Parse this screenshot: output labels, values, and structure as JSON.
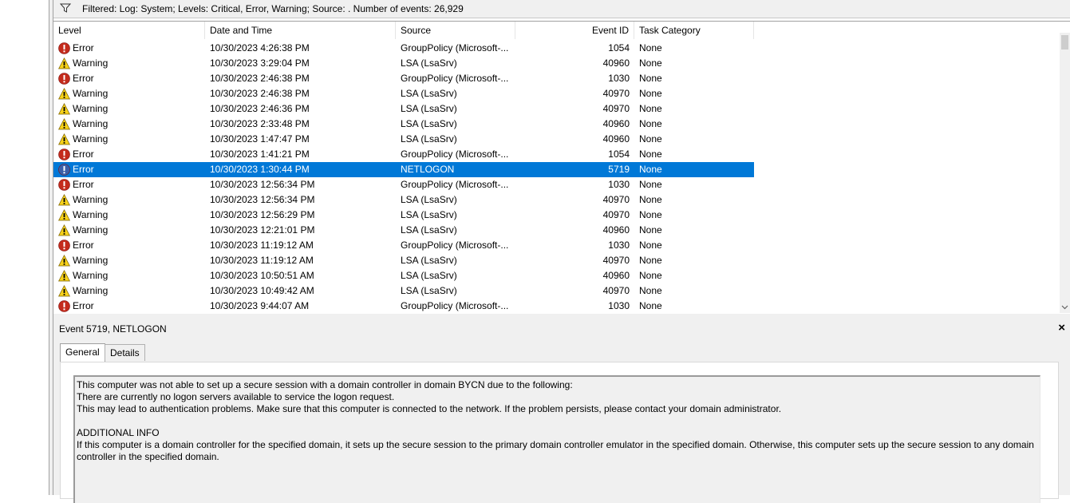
{
  "filter_bar": {
    "text": "Filtered: Log: System; Levels: Critical, Error, Warning; Source: . Number of events: 26,929",
    "icon": "filter-icon"
  },
  "table": {
    "columns": [
      "Level",
      "Date and Time",
      "Source",
      "Event ID",
      "Task Category"
    ],
    "rows": [
      {
        "level": "Error",
        "datetime": "10/30/2023 4:26:38 PM",
        "source": "GroupPolicy (Microsoft-...",
        "event_id": "1054",
        "category": "None"
      },
      {
        "level": "Warning",
        "datetime": "10/30/2023 3:29:04 PM",
        "source": "LSA (LsaSrv)",
        "event_id": "40960",
        "category": "None"
      },
      {
        "level": "Error",
        "datetime": "10/30/2023 2:46:38 PM",
        "source": "GroupPolicy (Microsoft-...",
        "event_id": "1030",
        "category": "None"
      },
      {
        "level": "Warning",
        "datetime": "10/30/2023 2:46:38 PM",
        "source": "LSA (LsaSrv)",
        "event_id": "40970",
        "category": "None"
      },
      {
        "level": "Warning",
        "datetime": "10/30/2023 2:46:36 PM",
        "source": "LSA (LsaSrv)",
        "event_id": "40970",
        "category": "None"
      },
      {
        "level": "Warning",
        "datetime": "10/30/2023 2:33:48 PM",
        "source": "LSA (LsaSrv)",
        "event_id": "40960",
        "category": "None"
      },
      {
        "level": "Warning",
        "datetime": "10/30/2023 1:47:47 PM",
        "source": "LSA (LsaSrv)",
        "event_id": "40960",
        "category": "None"
      },
      {
        "level": "Error",
        "datetime": "10/30/2023 1:41:21 PM",
        "source": "GroupPolicy (Microsoft-...",
        "event_id": "1054",
        "category": "None"
      },
      {
        "level": "Error",
        "datetime": "10/30/2023 1:30:44 PM",
        "source": "NETLOGON",
        "event_id": "5719",
        "category": "None",
        "selected": true
      },
      {
        "level": "Error",
        "datetime": "10/30/2023 12:56:34 PM",
        "source": "GroupPolicy (Microsoft-...",
        "event_id": "1030",
        "category": "None"
      },
      {
        "level": "Warning",
        "datetime": "10/30/2023 12:56:34 PM",
        "source": "LSA (LsaSrv)",
        "event_id": "40970",
        "category": "None"
      },
      {
        "level": "Warning",
        "datetime": "10/30/2023 12:56:29 PM",
        "source": "LSA (LsaSrv)",
        "event_id": "40970",
        "category": "None"
      },
      {
        "level": "Warning",
        "datetime": "10/30/2023 12:21:01 PM",
        "source": "LSA (LsaSrv)",
        "event_id": "40960",
        "category": "None"
      },
      {
        "level": "Error",
        "datetime": "10/30/2023 11:19:12 AM",
        "source": "GroupPolicy (Microsoft-...",
        "event_id": "1030",
        "category": "None"
      },
      {
        "level": "Warning",
        "datetime": "10/30/2023 11:19:12 AM",
        "source": "LSA (LsaSrv)",
        "event_id": "40970",
        "category": "None"
      },
      {
        "level": "Warning",
        "datetime": "10/30/2023 10:50:51 AM",
        "source": "LSA (LsaSrv)",
        "event_id": "40960",
        "category": "None"
      },
      {
        "level": "Warning",
        "datetime": "10/30/2023 10:49:42 AM",
        "source": "LSA (LsaSrv)",
        "event_id": "40970",
        "category": "None"
      },
      {
        "level": "Error",
        "datetime": "10/30/2023 9:44:07 AM",
        "source": "GroupPolicy (Microsoft-...",
        "event_id": "1030",
        "category": "None"
      }
    ]
  },
  "detail": {
    "title": "Event 5719, NETLOGON",
    "close_label": "×",
    "tabs": [
      "General",
      "Details"
    ],
    "message": {
      "line1": "This computer was not able to set up a secure session with a domain controller in domain BYCN due to the following:",
      "line2": "There are currently no logon servers available to service the logon request.",
      "line3": "This may lead to authentication problems. Make sure that this computer is connected to the network. If the problem persists, please contact your domain administrator.",
      "line4": "ADDITIONAL INFO",
      "line5": "If this computer is a domain controller for the specified domain, it sets up the secure session to the primary domain controller emulator in the specified domain. Otherwise, this computer sets up the secure session to any domain controller in the specified domain."
    }
  },
  "colors": {
    "selection": "#0078d7",
    "error_icon": "#c42b1c",
    "warning_icon": "#f7d21a",
    "selected_error_icon": "#3b5fa8"
  }
}
